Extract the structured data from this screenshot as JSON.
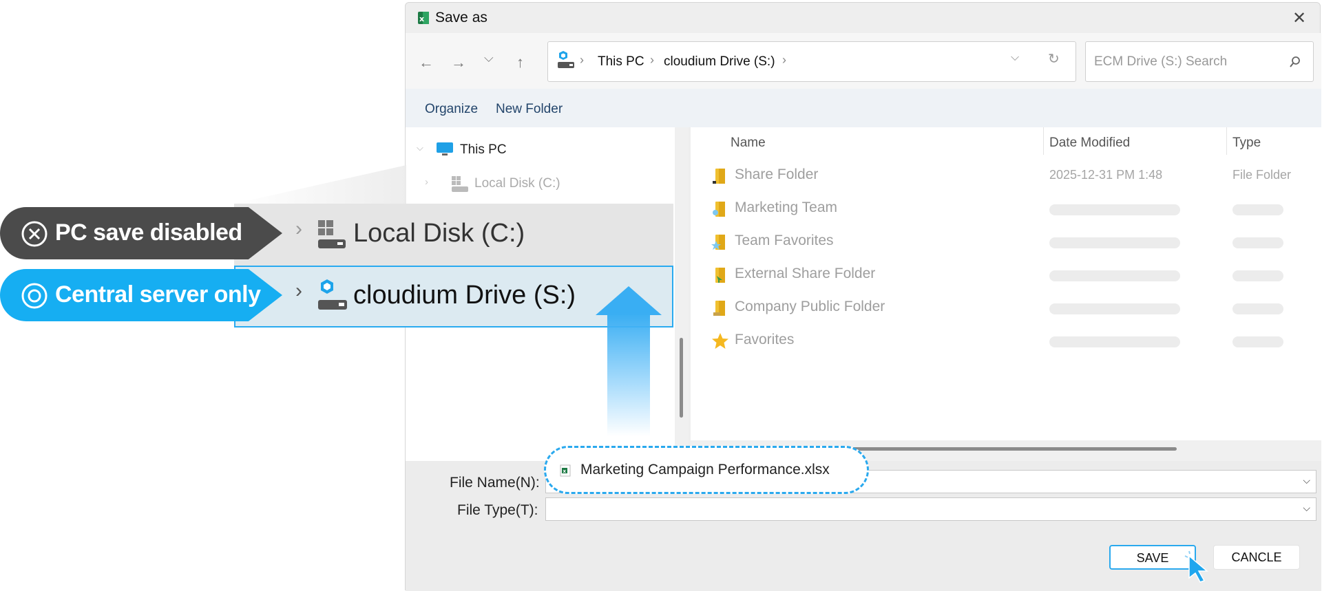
{
  "dialog": {
    "title": "Save as",
    "close_icon": "close-icon"
  },
  "address": {
    "crumbs": [
      "This PC",
      "cloudium Drive (S:)"
    ]
  },
  "search": {
    "placeholder": "ECM Drive (S:) Search"
  },
  "toolbar": {
    "organize": "Organize",
    "new_folder": "New Folder"
  },
  "nav": {
    "this_pc": "This PC",
    "local_disk_small": "Local Disk (C:)"
  },
  "columns": {
    "name": "Name",
    "date_modified": "Date Modified",
    "type": "Type"
  },
  "files": [
    {
      "name": "Share Folder",
      "date": "2025-12-31 PM 1:48",
      "type": "File Folder",
      "icon": "share-folder-icon"
    },
    {
      "name": "Marketing Team",
      "date": "",
      "type": "",
      "icon": "team-folder-icon"
    },
    {
      "name": "Team Favorites",
      "date": "",
      "type": "",
      "icon": "team-favorites-icon"
    },
    {
      "name": "External Share Folder",
      "date": "",
      "type": "",
      "icon": "external-share-folder-icon"
    },
    {
      "name": "Company Public Folder",
      "date": "",
      "type": "",
      "icon": "public-folder-icon"
    },
    {
      "name": "Favorites",
      "date": "",
      "type": "",
      "icon": "star-icon"
    }
  ],
  "form": {
    "file_name_label": "File Name(N):",
    "file_type_label": "File Type(T):",
    "file_name_value": "Marketing Campaign Performance.xlsx"
  },
  "buttons": {
    "save": "SAVE",
    "cancel": "CANCLE"
  },
  "callouts": {
    "disabled": "PC save disabled",
    "server_only": "Central server only",
    "local_disk": "Local Disk (C:)",
    "cloud_drive": "cloudium Drive (S:)"
  },
  "colors": {
    "accent": "#16aef2",
    "disabled_badge": "#4b4b4b",
    "highlight_row": "#dceaf1"
  }
}
